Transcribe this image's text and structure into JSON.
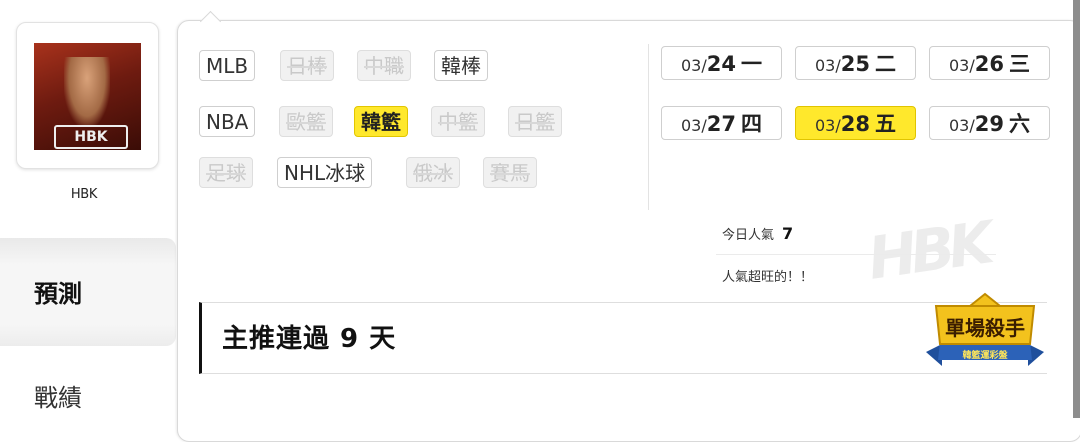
{
  "user": {
    "name": "HBK",
    "avatar_text": "HBK"
  },
  "nav": {
    "tabs": [
      {
        "label": "預測",
        "active": true
      },
      {
        "label": "戰績",
        "active": false
      }
    ]
  },
  "sports": [
    {
      "label": "MLB",
      "state": "enabled"
    },
    {
      "label": "日棒",
      "state": "disabled"
    },
    {
      "label": "中職",
      "state": "disabled"
    },
    {
      "label": "韓棒",
      "state": "enabled"
    },
    {
      "label": "NBA",
      "state": "enabled"
    },
    {
      "label": "歐籃",
      "state": "disabled"
    },
    {
      "label": "韓籃",
      "state": "active"
    },
    {
      "label": "中籃",
      "state": "disabled"
    },
    {
      "label": "日籃",
      "state": "disabled"
    },
    {
      "label": "足球",
      "state": "disabled"
    },
    {
      "label": "NHL冰球",
      "state": "enabled"
    },
    {
      "label": "俄冰",
      "state": "disabled"
    },
    {
      "label": "賽馬",
      "state": "disabled"
    }
  ],
  "dates": [
    {
      "month": "03/",
      "day": "24",
      "weekday": "一",
      "active": false
    },
    {
      "month": "03/",
      "day": "25",
      "weekday": "二",
      "active": false
    },
    {
      "month": "03/",
      "day": "26",
      "weekday": "三",
      "active": false
    },
    {
      "month": "03/",
      "day": "27",
      "weekday": "四",
      "active": false
    },
    {
      "month": "03/",
      "day": "28",
      "weekday": "五",
      "active": true
    },
    {
      "month": "03/",
      "day": "29",
      "weekday": "六",
      "active": false
    }
  ],
  "popularity": {
    "label": "今日人氣",
    "value": "7",
    "note": "人氣超旺的！！"
  },
  "streak": {
    "text": "主推連過 9 天"
  },
  "badge": {
    "title": "單場殺手",
    "subtitle": "韓籃運彩盤"
  },
  "colors": {
    "active_chip": "#ffe82c",
    "disabled_text": "#c9c9c9",
    "badge_gold": "#f3c21d",
    "badge_blue": "#1f4f9c"
  }
}
